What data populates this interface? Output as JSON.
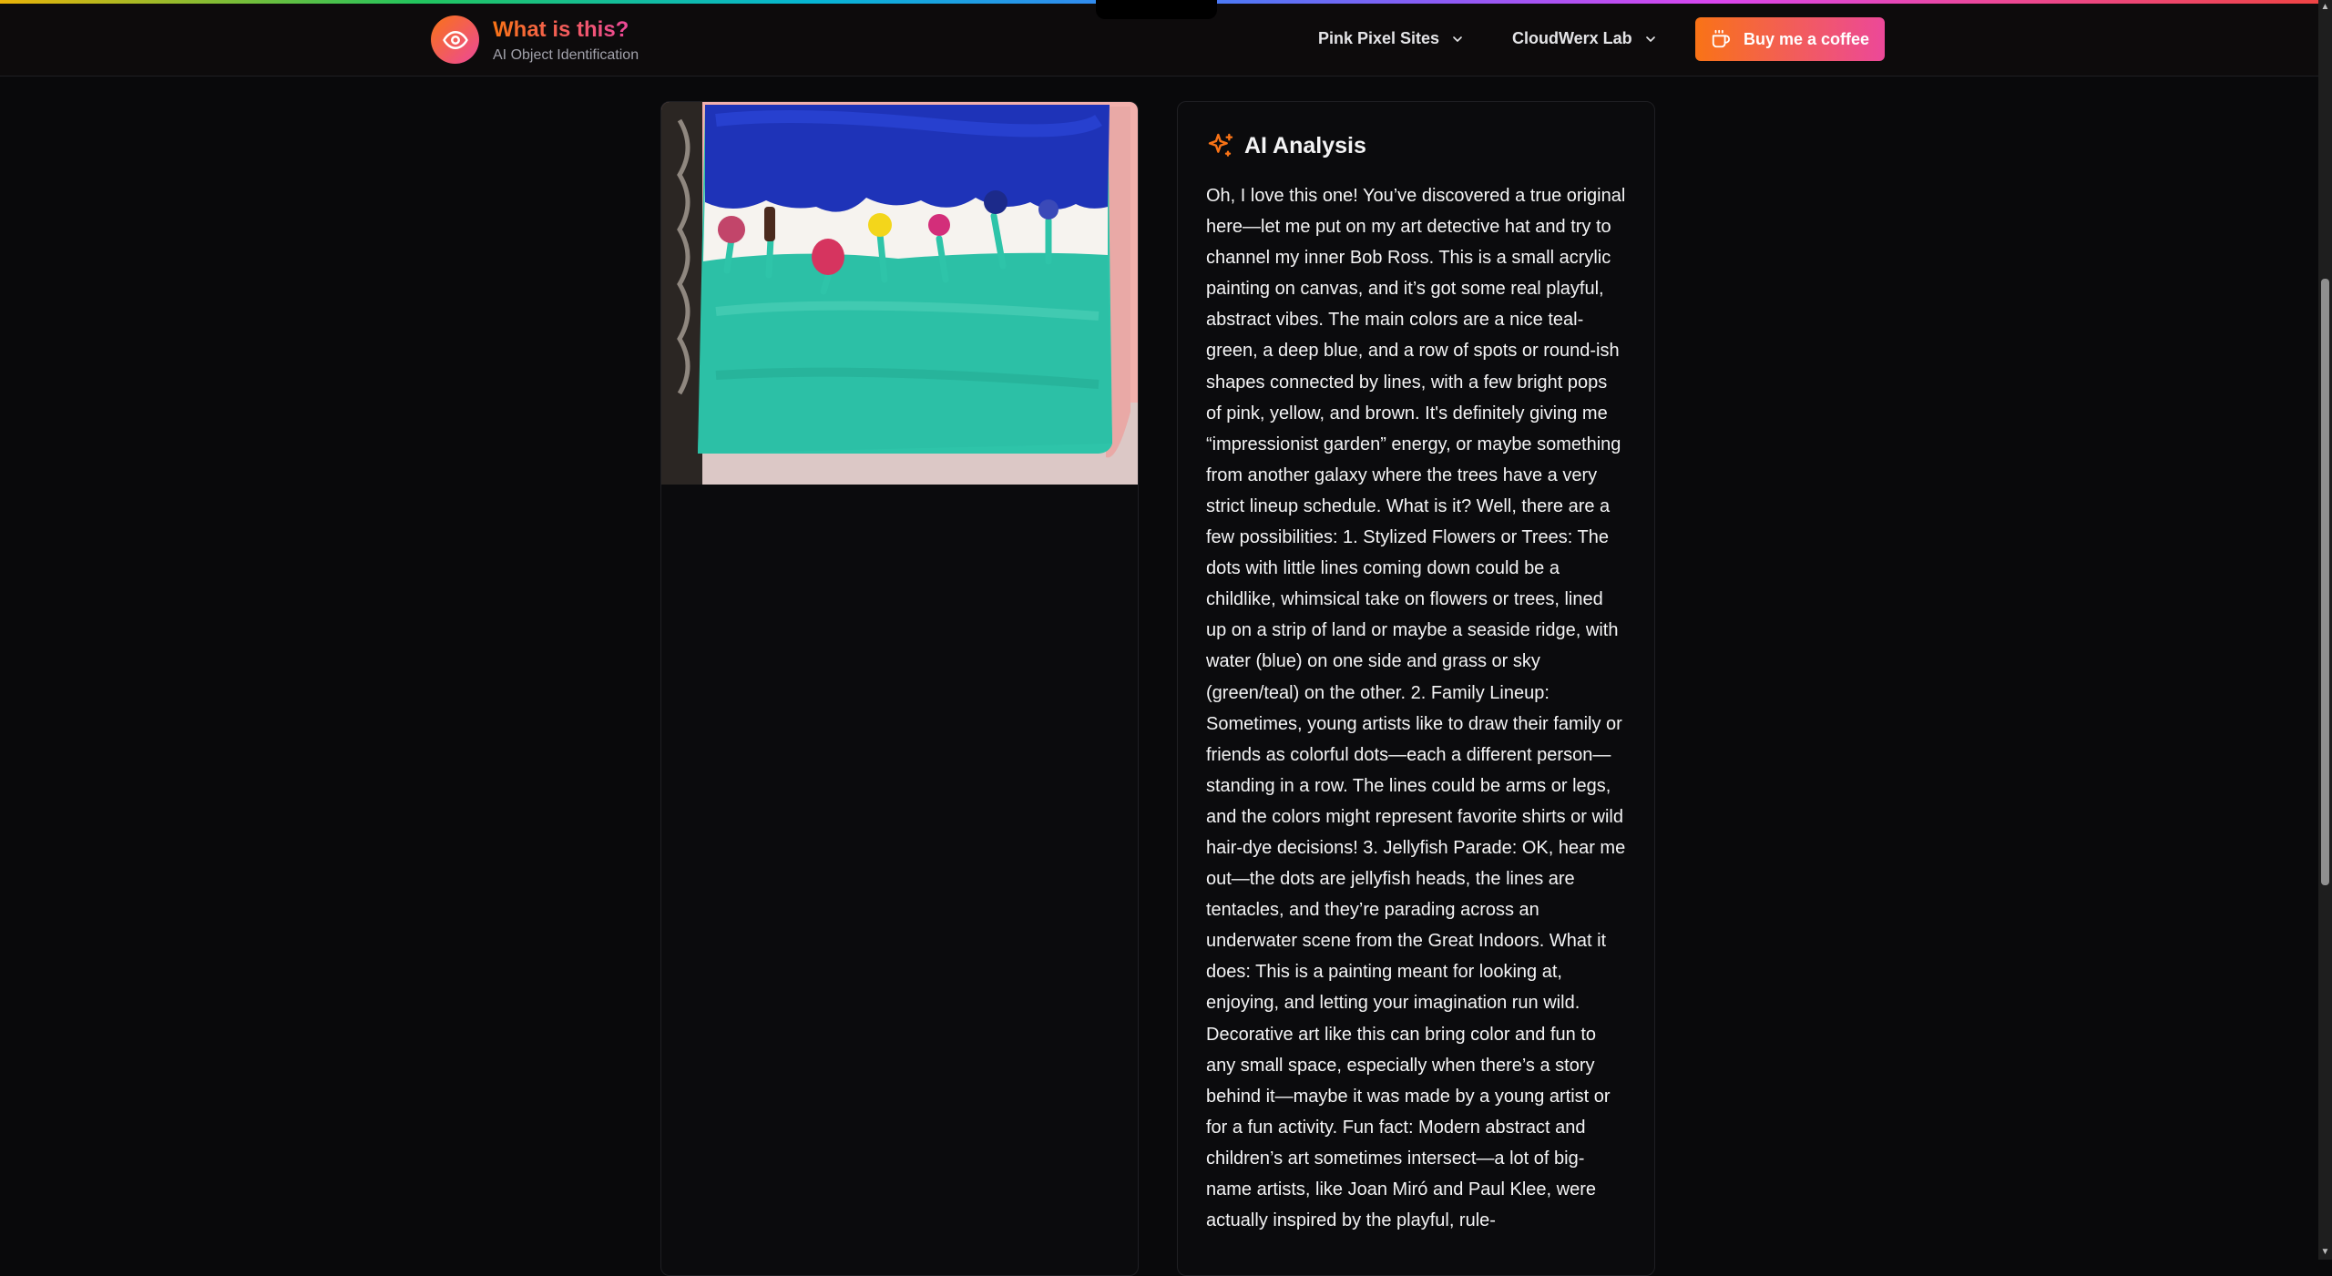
{
  "header": {
    "brand_title": "What is this?",
    "brand_subtitle": "AI Object Identification",
    "nav": [
      {
        "label": "Pink Pixel Sites"
      },
      {
        "label": "CloudWerx Lab"
      }
    ],
    "cta_label": "Buy me a coffee"
  },
  "analysis": {
    "title": "AI Analysis",
    "body": "Oh, I love this one! You’ve discovered a true original here—let me put on my art detective hat and try to channel my inner Bob Ross. This is a small acrylic painting on canvas, and it’s got some real playful, abstract vibes. The main colors are a nice teal-green, a deep blue, and a row of spots or round-ish shapes connected by lines, with a few bright pops of pink, yellow, and brown. It's definitely giving me “impressionist garden” energy, or maybe something from another galaxy where the trees have a very strict lineup schedule. What is it? Well, there are a few possibilities: 1. Stylized Flowers or Trees: The dots with little lines coming down could be a childlike, whimsical take on flowers or trees, lined up on a strip of land or maybe a seaside ridge, with water (blue) on one side and grass or sky (green/teal) on the other. 2. Family Lineup: Sometimes, young artists like to draw their family or friends as colorful dots—each a different person—standing in a row. The lines could be arms or legs, and the colors might represent favorite shirts or wild hair-dye decisions! 3. Jellyfish Parade: OK, hear me out—the dots are jellyfish heads, the lines are tentacles, and they’re parading across an underwater scene from the Great Indoors. What it does: This is a painting meant for looking at, enjoying, and letting your imagination run wild. Decorative art like this can bring color and fun to any small space, especially when there’s a story behind it—maybe it was made by a young artist or for a fun activity. Fun fact: Modern abstract and children’s art sometimes intersect—a lot of big-name artists, like Joan Miró and Paul Klee, were actually inspired by the playful, rule-"
  },
  "colors": {
    "accent_orange": "#f97316",
    "accent_pink": "#ec4899",
    "background": "#09090b"
  },
  "icons": {
    "logo": "eye-icon",
    "nav_chevron": "chevron-down-icon",
    "cta": "coffee-cup-icon",
    "analysis": "sparkles-icon"
  }
}
